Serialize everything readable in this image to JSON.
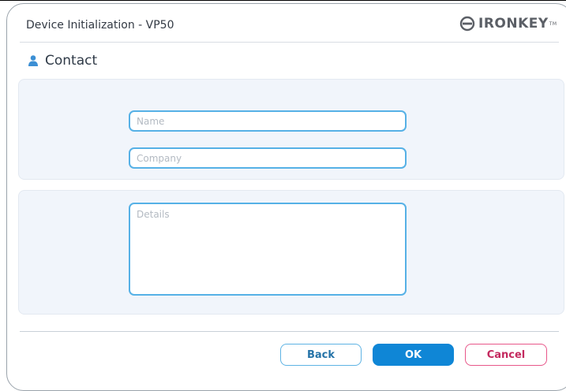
{
  "window": {
    "title": "Device Initialization - VP50",
    "brand": "IRONKEY",
    "brand_mark": "TM"
  },
  "section": {
    "title": "Contact",
    "icon": "person-icon"
  },
  "form": {
    "name_placeholder": "Name",
    "company_placeholder": "Company",
    "details_placeholder": "Details",
    "name_value": "",
    "company_value": "",
    "details_value": ""
  },
  "buttons": {
    "back_label": "Back",
    "ok_label": "OK",
    "cancel_label": "Cancel"
  },
  "colors": {
    "accent": "#0f86d6",
    "field_border": "#56b1e6",
    "cancel": "#e8578a",
    "panel": "#f1f5fb"
  }
}
